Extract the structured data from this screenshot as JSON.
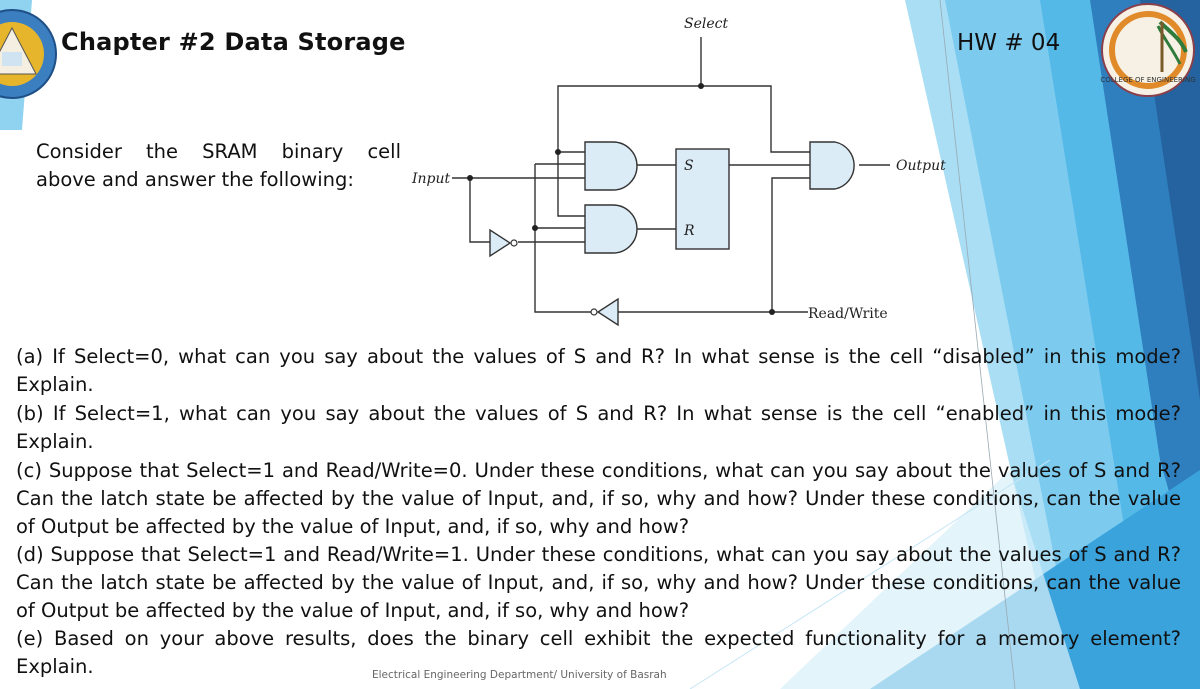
{
  "slide": {
    "title": "Chapter #2 Data Storage",
    "hw_label": "HW # 04",
    "intro_line1": "Consider the SRAM binary cell",
    "intro_line2": "above and answer the following:",
    "footer": "Electrical Engineering Department/ University of Basrah",
    "logos": {
      "left": "university-of-basrah-logo",
      "right": "college-of-engineering-logo",
      "right_text": "COLLEGE OF ENGINEERING"
    },
    "theme_colors": {
      "light_blue": "#8fd3f1",
      "mid_blue": "#4fb8e6",
      "deep_blue": "#2f7fbf",
      "navy_blue": "#24639f",
      "gate_fill": "#dcecf7"
    }
  },
  "circuit": {
    "labels": {
      "select": "Select",
      "input": "Input",
      "output": "Output",
      "read_write": "Read/Write",
      "s": "S",
      "r": "R"
    }
  },
  "questions": [
    {
      "id": "a",
      "text": "(a) If Select=0, what can you say about the values of S and R? In what sense is the cell “disabled” in this mode? Explain."
    },
    {
      "id": "b",
      "text": "(b) If Select=1, what can you say about the values of S and R? In what sense is the cell “enabled” in this mode? Explain."
    },
    {
      "id": "c",
      "text": "(c) Suppose that Select=1 and Read/Write=0. Under these conditions, what can you say about the values of S and R? Can the latch state be affected by the value of Input, and, if so, why and how? Under these conditions, can the value of Output be affected by the value of Input, and, if so, why and how?"
    },
    {
      "id": "d",
      "text": "(d) Suppose that Select=1 and Read/Write=1. Under these conditions, what can you say about the values of S and R? Can the latch state be affected by the value of Input, and, if so, why and how? Under these conditions, can the value of Output be affected by the value of Input, and, if so, why and how?"
    },
    {
      "id": "e",
      "text": "(e) Based on your above results, does the binary cell exhibit the expected functionality for a memory element? Explain."
    }
  ]
}
